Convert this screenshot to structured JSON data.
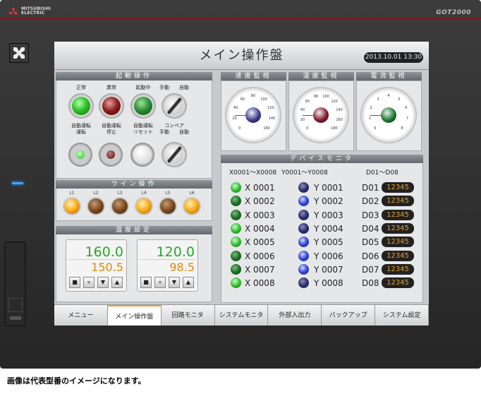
{
  "device": {
    "brand_line1": "MITSUBISHI",
    "brand_line2": "ELECTRIC",
    "model": "GOT2000"
  },
  "screen": {
    "title": "メイン操作盤",
    "datetime": "2013.10.01  13:30"
  },
  "start_ops": {
    "title": "起動操作",
    "row1": [
      {
        "label": "正常"
      },
      {
        "label": "異常"
      },
      {
        "label": "起動中"
      },
      {
        "label": "手動　　自動"
      }
    ],
    "row2": [
      {
        "label": "自動運転\n運転"
      },
      {
        "label": "自動運転\n停止"
      },
      {
        "label": "自動運転\nリセット"
      },
      {
        "label": "コンベア\n手動　　自動"
      }
    ]
  },
  "line_ops": {
    "title": "ライン操作",
    "lamps": [
      {
        "label": "L1",
        "on": true
      },
      {
        "label": "L2",
        "on": false
      },
      {
        "label": "L3",
        "on": false
      },
      {
        "label": "L4",
        "on": true
      },
      {
        "label": "L5",
        "on": false
      },
      {
        "label": "L6",
        "on": true
      }
    ]
  },
  "temp": {
    "title": "温度設定",
    "units": [
      {
        "pv": "160.0",
        "sv": "150.5"
      },
      {
        "pv": "120.0",
        "sv": "98.5"
      }
    ],
    "buttons": [
      "■",
      "«",
      "▼",
      "▲"
    ]
  },
  "gauges": [
    {
      "title": "速度監視",
      "ticks": [
        "0",
        "20",
        "40",
        "60",
        "80",
        "100",
        "120",
        "140",
        "160"
      ],
      "hub": "#3a3e92"
    },
    {
      "title": "温度監視",
      "ticks": [
        "0",
        "20",
        "40",
        "60",
        "80",
        "100",
        "120",
        "140",
        "160",
        "180"
      ],
      "hub": "#8a1a2a"
    },
    {
      "title": "電流監視",
      "ticks": [
        "0",
        "1",
        "2",
        "3",
        "4",
        "5",
        "6",
        "7",
        "8"
      ],
      "hub": "#1c7a30"
    }
  ],
  "device_monitor": {
    "title": "デバイスモニタ",
    "headers": [
      "X0001～X0008",
      "Y0001～Y0008",
      "D01～D08"
    ],
    "rows": [
      {
        "x": "X 0001",
        "xon": true,
        "y": "Y 0001",
        "yon": false,
        "d": "D01",
        "dv": "12345"
      },
      {
        "x": "X 0002",
        "xon": false,
        "y": "Y 0002",
        "yon": true,
        "d": "D02",
        "dv": "12345"
      },
      {
        "x": "X 0003",
        "xon": false,
        "y": "Y 0003",
        "yon": false,
        "d": "D03",
        "dv": "12345"
      },
      {
        "x": "X 0004",
        "xon": true,
        "y": "Y 0004",
        "yon": false,
        "d": "D04",
        "dv": "12345"
      },
      {
        "x": "X 0005",
        "xon": true,
        "y": "Y 0005",
        "yon": true,
        "d": "D05",
        "dv": "12345"
      },
      {
        "x": "X 0006",
        "xon": false,
        "y": "Y 0006",
        "yon": true,
        "d": "D06",
        "dv": "12345"
      },
      {
        "x": "X 0007",
        "xon": false,
        "y": "Y 0007",
        "yon": true,
        "d": "D07",
        "dv": "12345"
      },
      {
        "x": "X 0008",
        "xon": true,
        "y": "Y 0008",
        "yon": false,
        "d": "D08",
        "dv": "12345"
      }
    ]
  },
  "menu": [
    {
      "label": "メニュー"
    },
    {
      "label": "メイン操作盤",
      "active": true
    },
    {
      "label": "回路モニタ"
    },
    {
      "label": "システムモニタ"
    },
    {
      "label": "外部入出力"
    },
    {
      "label": "バックアップ"
    },
    {
      "label": "システム設定"
    }
  ],
  "caption": "画像は代表型番のイメージになります。"
}
